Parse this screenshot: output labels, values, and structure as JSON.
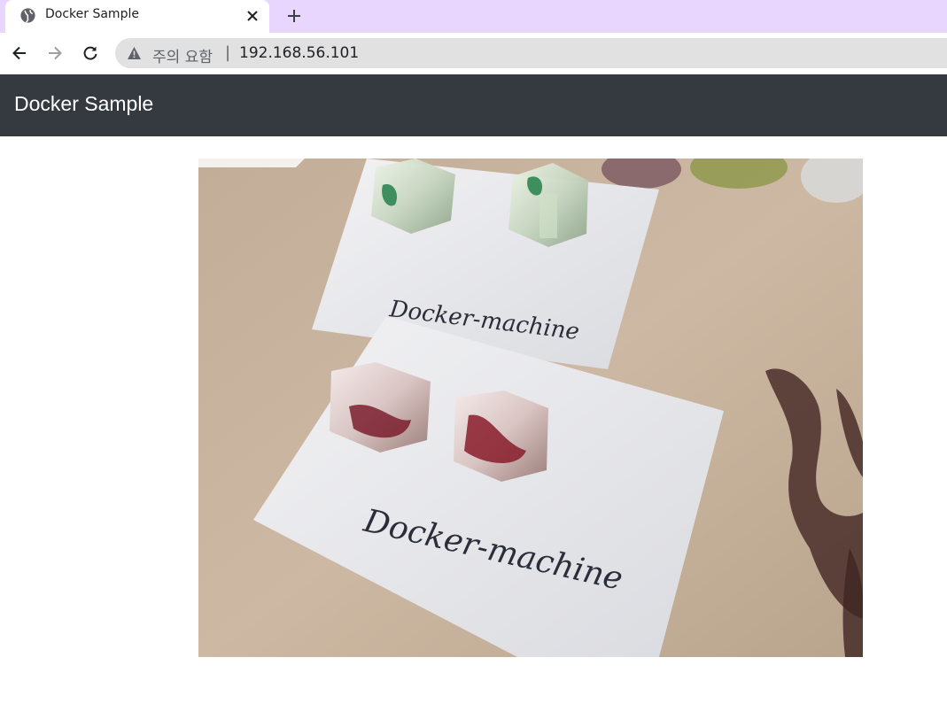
{
  "browser": {
    "tab": {
      "title": "Docker Sample",
      "favicon": "globe-icon",
      "close_icon": "close-icon"
    },
    "new_tab_icon": "plus-icon",
    "toolbar": {
      "back_icon": "arrow-left-icon",
      "forward_icon": "arrow-right-icon",
      "reload_icon": "reload-icon"
    },
    "address_bar": {
      "security_icon": "warning-triangle-icon",
      "security_label": "주의 요함",
      "separator": "|",
      "url": "192.168.56.101"
    },
    "colors": {
      "tab_strip": "#e9d6ff",
      "omnibox": "#e1e1e1"
    }
  },
  "page": {
    "navbar": {
      "brand": "Docker Sample",
      "background": "#343a40"
    },
    "image": {
      "alt": "photo of resin cube earrings on cards",
      "card_text_back": "Docker-machine",
      "card_text_front": "Docker-machine"
    }
  }
}
